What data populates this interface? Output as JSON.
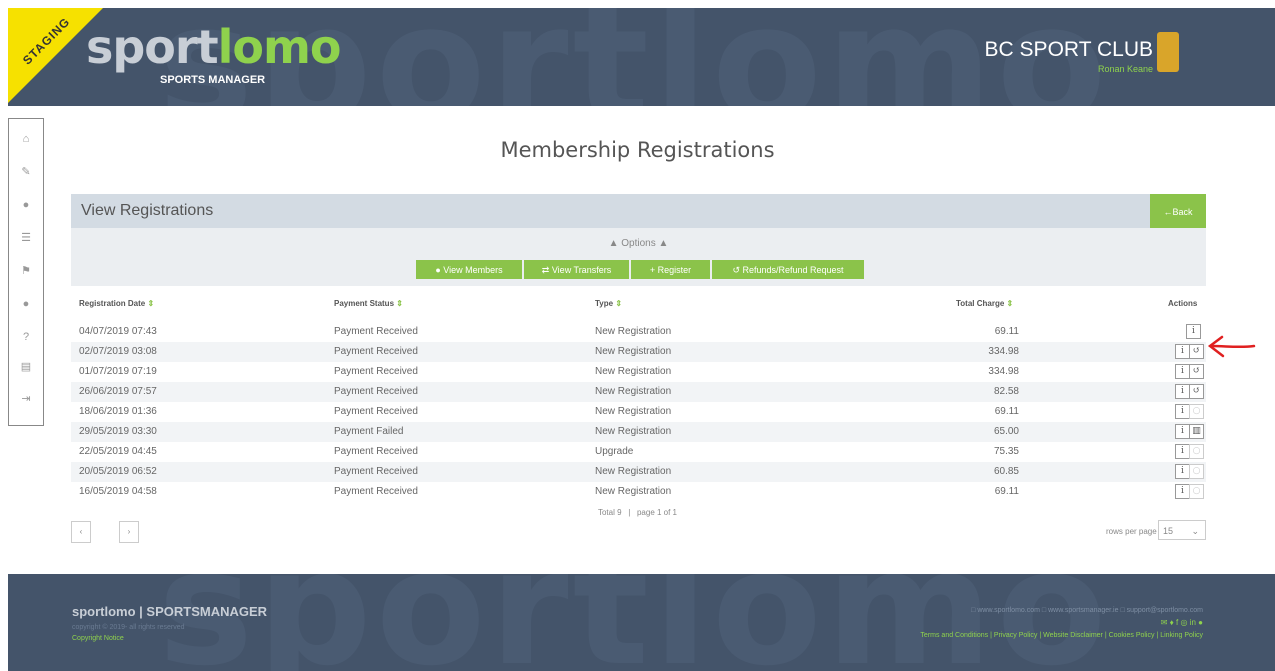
{
  "header": {
    "staging": "STAGING",
    "bg_word": "sportlomo",
    "logo_part1": "sport",
    "logo_part2": "lomo",
    "logo_sub": "SPORTS MANAGER",
    "club_name": "BC SPORT CLUB",
    "user_name": "Ronan Keane"
  },
  "sidebar": {
    "items": [
      "home-icon",
      "edit-icon",
      "user-icon",
      "list-icon",
      "flag-icon",
      "user-icon",
      "help-icon",
      "document-icon",
      "logout-icon"
    ]
  },
  "page": {
    "title": "Membership Registrations",
    "panel_title": "View Registrations",
    "back_label": "←Back",
    "options_label": "▲  Options  ▲"
  },
  "options": {
    "view_members": "View Members",
    "view_transfers": "View Transfers",
    "register": "Register",
    "refunds": "Refunds/Refund Request"
  },
  "table": {
    "headers": {
      "date": "Registration Date",
      "status": "Payment Status",
      "type": "Type",
      "charge": "Total Charge",
      "actions": "Actions"
    },
    "rows": [
      {
        "date": "04/07/2019 07:43",
        "status": "Payment Received",
        "type": "New Registration",
        "charge": "69.11",
        "actions": [
          "info"
        ]
      },
      {
        "date": "02/07/2019 03:08",
        "status": "Payment Received",
        "type": "New Registration",
        "charge": "334.98",
        "actions": [
          "info",
          "refund"
        ]
      },
      {
        "date": "01/07/2019 07:19",
        "status": "Payment Received",
        "type": "New Registration",
        "charge": "334.98",
        "actions": [
          "info",
          "refund"
        ]
      },
      {
        "date": "26/06/2019 07:57",
        "status": "Payment Received",
        "type": "New Registration",
        "charge": "82.58",
        "actions": [
          "info",
          "refund"
        ]
      },
      {
        "date": "18/06/2019 01:36",
        "status": "Payment Received",
        "type": "New Registration",
        "charge": "69.11",
        "actions": [
          "info",
          "disabled"
        ]
      },
      {
        "date": "29/05/2019 03:30",
        "status": "Payment Failed",
        "type": "New Registration",
        "charge": "65.00",
        "actions": [
          "info",
          "delete"
        ]
      },
      {
        "date": "22/05/2019 04:45",
        "status": "Payment Received",
        "type": "Upgrade",
        "charge": "75.35",
        "actions": [
          "info",
          "disabled"
        ]
      },
      {
        "date": "20/05/2019 06:52",
        "status": "Payment Received",
        "type": "New Registration",
        "charge": "60.85",
        "actions": [
          "info",
          "disabled"
        ]
      },
      {
        "date": "16/05/2019 04:58",
        "status": "Payment Received",
        "type": "New Registration",
        "charge": "69.11",
        "actions": [
          "info",
          "disabled"
        ]
      }
    ]
  },
  "pagination": {
    "total": "Total 9",
    "page_info": "page 1 of 1",
    "prev": "‹",
    "next": "›",
    "rows_per_page_label": "rows per page",
    "rows_per_page_value": "15"
  },
  "footer": {
    "logo": "sportlomo  |  SPORTSMANAGER",
    "copyright": "copyright © 2019- all rights reserved",
    "notice": "Copyright Notice",
    "sites": "□ www.sportlomo.com  □ www.sportsmanager.ie  □ support@sportlomo.com",
    "links": "Terms and Conditions | Privacy Policy | Website Disclaimer | Cookies Policy | Linking Policy"
  },
  "colors": {
    "header_bg": "#44546a",
    "accent_green": "#8bc34a",
    "staging_yellow": "#f6e100",
    "arrow_red": "#e02020"
  }
}
